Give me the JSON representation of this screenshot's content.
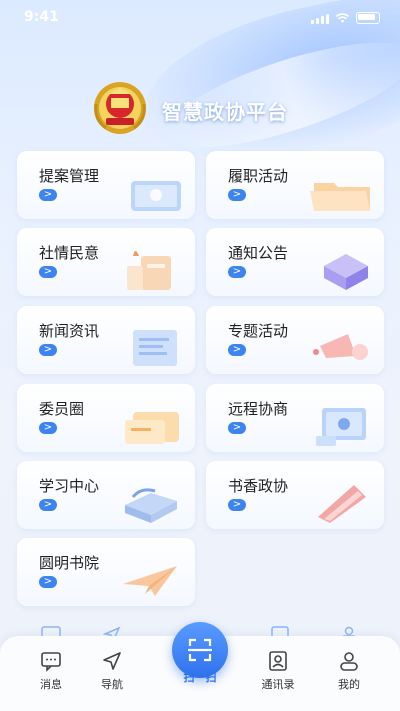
{
  "status_bar": {
    "time": "9:41"
  },
  "header": {
    "title": "智慧政协平台"
  },
  "menu": [
    {
      "label": "提案管理",
      "arrow": ">",
      "icon": "laptop-illustration"
    },
    {
      "label": "履职活动",
      "arrow": ">",
      "icon": "folder-illustration"
    },
    {
      "label": "社情民意",
      "arrow": ">",
      "icon": "building-illustration"
    },
    {
      "label": "通知公告",
      "arrow": ">",
      "icon": "cube-illustration"
    },
    {
      "label": "新闻资讯",
      "arrow": ">",
      "icon": "document-illustration"
    },
    {
      "label": "专题活动",
      "arrow": ">",
      "icon": "megaphone-illustration"
    },
    {
      "label": "委员圈",
      "arrow": ">",
      "icon": "card-illustration"
    },
    {
      "label": "远程协商",
      "arrow": ">",
      "icon": "video-call-illustration"
    },
    {
      "label": "学习中心",
      "arrow": ">",
      "icon": "books-illustration"
    },
    {
      "label": "书香政协",
      "arrow": ">",
      "icon": "book-illustration"
    },
    {
      "label": "圆明书院",
      "arrow": ">",
      "icon": "paper-plane-illustration"
    }
  ],
  "tabbar": {
    "messages": "消息",
    "navigation": "导航",
    "scan": "扫一扫",
    "contacts": "通讯录",
    "mine": "我的"
  },
  "colors": {
    "accent": "#3d84f0",
    "fab": "#2f72ec"
  }
}
